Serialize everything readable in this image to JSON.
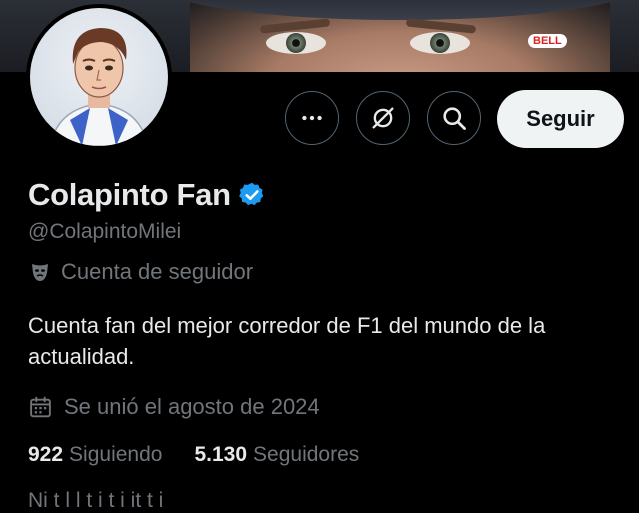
{
  "profile": {
    "display_name": "Colapinto Fan",
    "handle": "@ColapintoMilei",
    "affiliation_label": "Cuenta de seguidor",
    "bio": "Cuenta fan del mejor corredor de F1 del mundo de la actualidad.",
    "joined": "Se unió el agosto de 2024",
    "following_count": "922",
    "following_label": "Siguiendo",
    "followers_count": "5.130",
    "followers_label": "Seguidores",
    "truncated_line": "Ni t   l  l     t       i t  i  it       t      i"
  },
  "actions": {
    "more_icon": "ellipsis-icon",
    "grok_icon": "grok-icon",
    "search_icon": "search-icon",
    "follow_label": "Seguir"
  },
  "banner": {
    "sponsor_text": "BELL"
  },
  "colors": {
    "background": "#000000",
    "primary_text": "#e7e9ea",
    "secondary_text": "#71767b",
    "verified_blue": "#1d9bf0",
    "follow_button_bg": "#eff3f4",
    "button_border": "#536471"
  }
}
